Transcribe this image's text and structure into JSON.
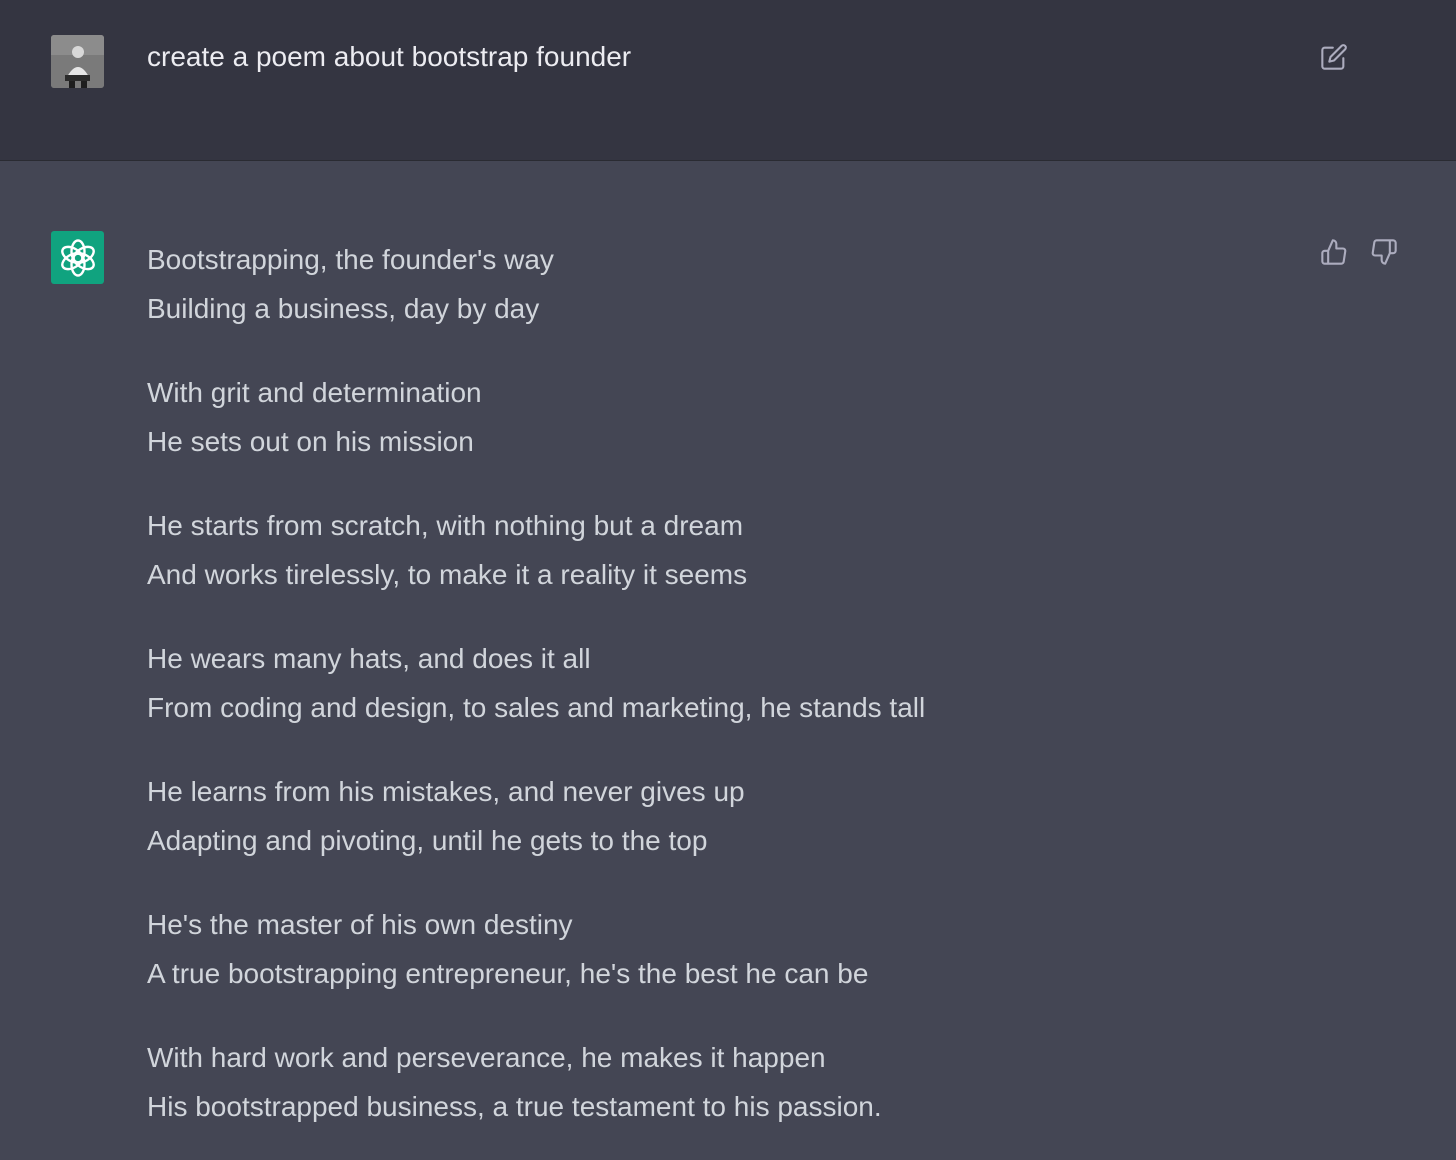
{
  "user_message": {
    "text": "create a poem about bootstrap founder",
    "avatar_icon": "user-photo-avatar",
    "edit_icon": "edit-icon"
  },
  "assistant_message": {
    "avatar_icon": "openai-logo-icon",
    "avatar_color": "#10a37f",
    "feedback_icons": [
      "thumbs-up-icon",
      "thumbs-down-icon"
    ],
    "stanzas": [
      [
        "Bootstrapping, the founder's way",
        "Building a business, day by day"
      ],
      [
        "With grit and determination",
        "He sets out on his mission"
      ],
      [
        "He starts from scratch, with nothing but a dream",
        "And works tirelessly, to make it a reality it seems"
      ],
      [
        "He wears many hats, and does it all",
        "From coding and design, to sales and marketing, he stands tall"
      ],
      [
        "He learns from his mistakes, and never gives up",
        "Adapting and pivoting, until he gets to the top"
      ],
      [
        "He's the master of his own destiny",
        "A true bootstrapping entrepreneur, he's the best he can be"
      ],
      [
        "With hard work and perseverance, he makes it happen",
        "His bootstrapped business, a true testament to his passion."
      ]
    ]
  },
  "colors": {
    "user_bg": "#343541",
    "assistant_bg": "#444654",
    "prompt_text": "#ececf1",
    "poem_text": "#d1d5db",
    "icon": "#acacbe"
  }
}
